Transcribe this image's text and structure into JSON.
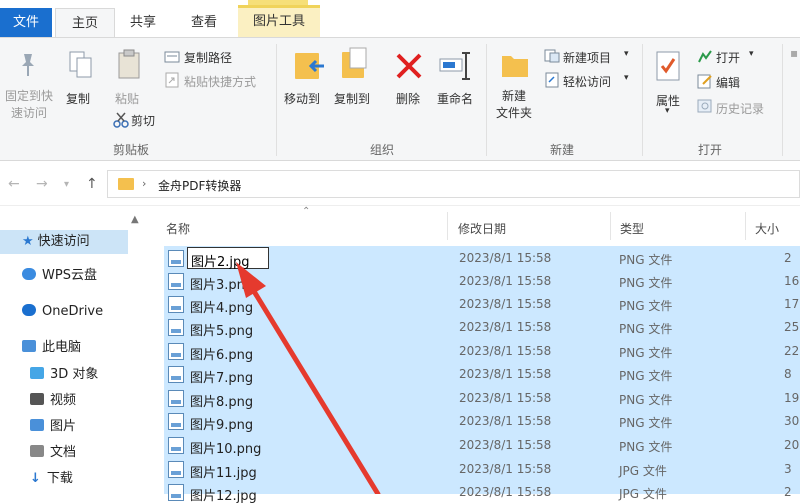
{
  "tabs": {
    "file": "文件",
    "home": "主页",
    "share": "共享",
    "view": "查看",
    "picture_tools": "图片工具"
  },
  "ribbon": {
    "clipboard": {
      "pin_quick_access": "固定到快\n速访问",
      "copy": "复制",
      "paste": "粘贴",
      "copy_path": "复制路径",
      "paste_shortcut": "粘贴快捷方式",
      "cut": "剪切",
      "group_label": "剪贴板"
    },
    "organize": {
      "move_to": "移动到",
      "copy_to": "复制到",
      "delete": "删除",
      "rename": "重命名",
      "group_label": "组织"
    },
    "new": {
      "new_folder": "新建\n文件夹",
      "new_item": "新建项目",
      "easy_access": "轻松访问",
      "group_label": "新建"
    },
    "open": {
      "properties": "属性",
      "open": "打开",
      "edit": "编辑",
      "history": "历史记录",
      "group_label": "打开"
    }
  },
  "address": {
    "breadcrumb": "金舟PDF转换器"
  },
  "nav_pane": {
    "items": [
      {
        "label": "快速访问",
        "icon": "star-icon",
        "color": "#2b78d0"
      },
      {
        "label": "WPS云盘",
        "icon": "cloud-icon",
        "color": "#3a8be0"
      },
      {
        "label": "OneDrive",
        "icon": "onedrive-icon",
        "color": "#1a6fcf"
      },
      {
        "label": "此电脑",
        "icon": "computer-icon",
        "color": "#4a90d9"
      },
      {
        "label": "3D 对象",
        "icon": "cube-icon",
        "color": "#45a6e6"
      },
      {
        "label": "视频",
        "icon": "video-icon",
        "color": "#555"
      },
      {
        "label": "图片",
        "icon": "picture-icon",
        "color": "#4a90d9"
      },
      {
        "label": "文档",
        "icon": "document-icon",
        "color": "#777"
      },
      {
        "label": "下载",
        "icon": "download-icon",
        "color": "#2b78d0"
      }
    ]
  },
  "file_list": {
    "columns": {
      "name": "名称",
      "date": "修改日期",
      "type": "类型",
      "size": "大小"
    },
    "rename_value": "图片2.jpg",
    "rows": [
      {
        "name": "图片2.jpg",
        "date": "2023/8/1 15:58",
        "type": "PNG 文件",
        "size": "2"
      },
      {
        "name": "图片3.png",
        "date": "2023/8/1 15:58",
        "type": "PNG 文件",
        "size": "16"
      },
      {
        "name": "图片4.png",
        "date": "2023/8/1 15:58",
        "type": "PNG 文件",
        "size": "17"
      },
      {
        "name": "图片5.png",
        "date": "2023/8/1 15:58",
        "type": "PNG 文件",
        "size": "25"
      },
      {
        "name": "图片6.png",
        "date": "2023/8/1 15:58",
        "type": "PNG 文件",
        "size": "22"
      },
      {
        "name": "图片7.png",
        "date": "2023/8/1 15:58",
        "type": "PNG 文件",
        "size": "8"
      },
      {
        "name": "图片8.png",
        "date": "2023/8/1 15:58",
        "type": "PNG 文件",
        "size": "19"
      },
      {
        "name": "图片9.png",
        "date": "2023/8/1 15:58",
        "type": "PNG 文件",
        "size": "30"
      },
      {
        "name": "图片10.png",
        "date": "2023/8/1 15:58",
        "type": "PNG 文件",
        "size": "20"
      },
      {
        "name": "图片11.jpg",
        "date": "2023/8/1 15:58",
        "type": "JPG 文件",
        "size": "3"
      },
      {
        "name": "图片12.jpg",
        "date": "2023/8/1 15:58",
        "type": "JPG 文件",
        "size": "2"
      }
    ]
  },
  "colors": {
    "accent": "#1a6fcf",
    "selection": "#cce8ff",
    "annotation_arrow": "#e53a2e"
  }
}
